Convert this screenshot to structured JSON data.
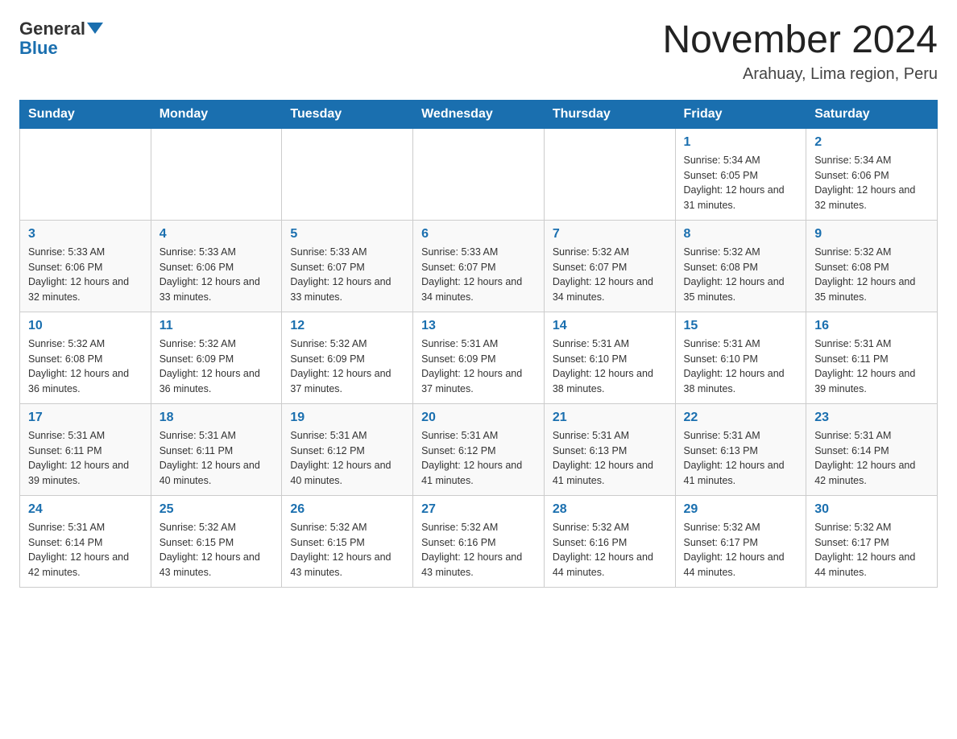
{
  "header": {
    "logo_general": "General",
    "logo_blue": "Blue",
    "month_year": "November 2024",
    "location": "Arahuay, Lima region, Peru"
  },
  "days_of_week": [
    "Sunday",
    "Monday",
    "Tuesday",
    "Wednesday",
    "Thursday",
    "Friday",
    "Saturday"
  ],
  "weeks": [
    [
      {
        "day": "",
        "info": ""
      },
      {
        "day": "",
        "info": ""
      },
      {
        "day": "",
        "info": ""
      },
      {
        "day": "",
        "info": ""
      },
      {
        "day": "",
        "info": ""
      },
      {
        "day": "1",
        "info": "Sunrise: 5:34 AM\nSunset: 6:05 PM\nDaylight: 12 hours and 31 minutes."
      },
      {
        "day": "2",
        "info": "Sunrise: 5:34 AM\nSunset: 6:06 PM\nDaylight: 12 hours and 32 minutes."
      }
    ],
    [
      {
        "day": "3",
        "info": "Sunrise: 5:33 AM\nSunset: 6:06 PM\nDaylight: 12 hours and 32 minutes."
      },
      {
        "day": "4",
        "info": "Sunrise: 5:33 AM\nSunset: 6:06 PM\nDaylight: 12 hours and 33 minutes."
      },
      {
        "day": "5",
        "info": "Sunrise: 5:33 AM\nSunset: 6:07 PM\nDaylight: 12 hours and 33 minutes."
      },
      {
        "day": "6",
        "info": "Sunrise: 5:33 AM\nSunset: 6:07 PM\nDaylight: 12 hours and 34 minutes."
      },
      {
        "day": "7",
        "info": "Sunrise: 5:32 AM\nSunset: 6:07 PM\nDaylight: 12 hours and 34 minutes."
      },
      {
        "day": "8",
        "info": "Sunrise: 5:32 AM\nSunset: 6:08 PM\nDaylight: 12 hours and 35 minutes."
      },
      {
        "day": "9",
        "info": "Sunrise: 5:32 AM\nSunset: 6:08 PM\nDaylight: 12 hours and 35 minutes."
      }
    ],
    [
      {
        "day": "10",
        "info": "Sunrise: 5:32 AM\nSunset: 6:08 PM\nDaylight: 12 hours and 36 minutes."
      },
      {
        "day": "11",
        "info": "Sunrise: 5:32 AM\nSunset: 6:09 PM\nDaylight: 12 hours and 36 minutes."
      },
      {
        "day": "12",
        "info": "Sunrise: 5:32 AM\nSunset: 6:09 PM\nDaylight: 12 hours and 37 minutes."
      },
      {
        "day": "13",
        "info": "Sunrise: 5:31 AM\nSunset: 6:09 PM\nDaylight: 12 hours and 37 minutes."
      },
      {
        "day": "14",
        "info": "Sunrise: 5:31 AM\nSunset: 6:10 PM\nDaylight: 12 hours and 38 minutes."
      },
      {
        "day": "15",
        "info": "Sunrise: 5:31 AM\nSunset: 6:10 PM\nDaylight: 12 hours and 38 minutes."
      },
      {
        "day": "16",
        "info": "Sunrise: 5:31 AM\nSunset: 6:11 PM\nDaylight: 12 hours and 39 minutes."
      }
    ],
    [
      {
        "day": "17",
        "info": "Sunrise: 5:31 AM\nSunset: 6:11 PM\nDaylight: 12 hours and 39 minutes."
      },
      {
        "day": "18",
        "info": "Sunrise: 5:31 AM\nSunset: 6:11 PM\nDaylight: 12 hours and 40 minutes."
      },
      {
        "day": "19",
        "info": "Sunrise: 5:31 AM\nSunset: 6:12 PM\nDaylight: 12 hours and 40 minutes."
      },
      {
        "day": "20",
        "info": "Sunrise: 5:31 AM\nSunset: 6:12 PM\nDaylight: 12 hours and 41 minutes."
      },
      {
        "day": "21",
        "info": "Sunrise: 5:31 AM\nSunset: 6:13 PM\nDaylight: 12 hours and 41 minutes."
      },
      {
        "day": "22",
        "info": "Sunrise: 5:31 AM\nSunset: 6:13 PM\nDaylight: 12 hours and 41 minutes."
      },
      {
        "day": "23",
        "info": "Sunrise: 5:31 AM\nSunset: 6:14 PM\nDaylight: 12 hours and 42 minutes."
      }
    ],
    [
      {
        "day": "24",
        "info": "Sunrise: 5:31 AM\nSunset: 6:14 PM\nDaylight: 12 hours and 42 minutes."
      },
      {
        "day": "25",
        "info": "Sunrise: 5:32 AM\nSunset: 6:15 PM\nDaylight: 12 hours and 43 minutes."
      },
      {
        "day": "26",
        "info": "Sunrise: 5:32 AM\nSunset: 6:15 PM\nDaylight: 12 hours and 43 minutes."
      },
      {
        "day": "27",
        "info": "Sunrise: 5:32 AM\nSunset: 6:16 PM\nDaylight: 12 hours and 43 minutes."
      },
      {
        "day": "28",
        "info": "Sunrise: 5:32 AM\nSunset: 6:16 PM\nDaylight: 12 hours and 44 minutes."
      },
      {
        "day": "29",
        "info": "Sunrise: 5:32 AM\nSunset: 6:17 PM\nDaylight: 12 hours and 44 minutes."
      },
      {
        "day": "30",
        "info": "Sunrise: 5:32 AM\nSunset: 6:17 PM\nDaylight: 12 hours and 44 minutes."
      }
    ]
  ]
}
